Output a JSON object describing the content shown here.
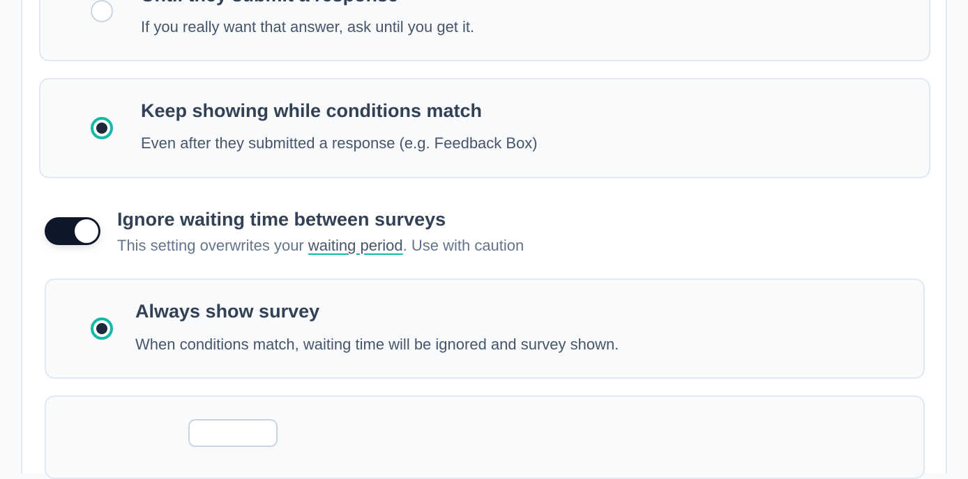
{
  "options": {
    "until_submit": {
      "title": "Until they submit a response",
      "description": "If you really want that answer, ask until you get it.",
      "selected": false
    },
    "keep_showing": {
      "title": "Keep showing while conditions match",
      "description": "Even after they submitted a response (e.g. Feedback Box)",
      "selected": true
    }
  },
  "ignore_waiting": {
    "enabled": true,
    "title": "Ignore waiting time between surveys",
    "description_before": "This setting overwrites your ",
    "link_text": "waiting period",
    "description_after": ". Use with caution"
  },
  "sub_options": {
    "always_show": {
      "title": "Always show survey",
      "description": "When conditions match, waiting time will be ignored and survey shown.",
      "selected": true
    }
  },
  "colors": {
    "accent": "#14b8a6",
    "toggle_on": "#0f172a"
  }
}
